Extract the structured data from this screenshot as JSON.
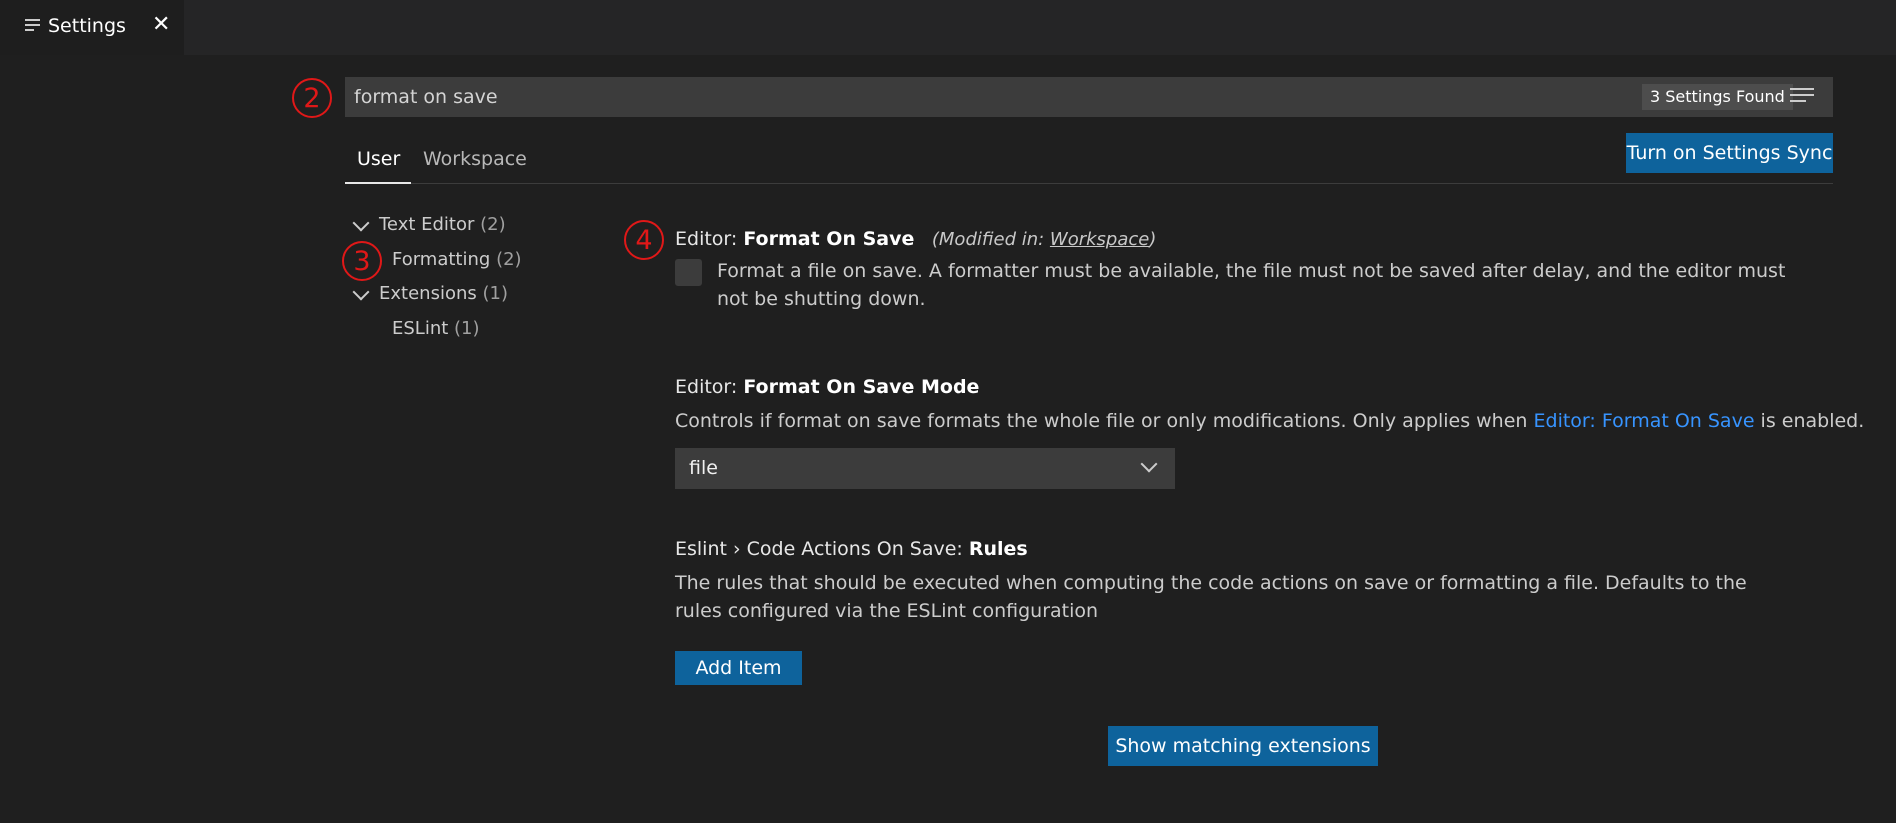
{
  "tab": {
    "title": "Settings",
    "close": "✕"
  },
  "annotations": {
    "search": "2",
    "toc": "3",
    "setting": "4"
  },
  "search": {
    "value": "format on save",
    "found": "3 Settings Found"
  },
  "scopes": {
    "user": "User",
    "workspace": "Workspace"
  },
  "sync_button": "Turn on Settings Sync",
  "toc": [
    {
      "label": "Text Editor",
      "count": "(2)"
    },
    {
      "label": "Formatting",
      "count": "(2)"
    },
    {
      "label": "Extensions",
      "count": "(1)"
    },
    {
      "label": "ESLint",
      "count": "(1)"
    }
  ],
  "settings": {
    "format_on_save": {
      "category": "Editor: ",
      "name": "Format On Save",
      "modified_prefix": "(Modified in: ",
      "modified_link": "Workspace",
      "modified_suffix": ")",
      "description": "Format a file on save. A formatter must be available, the file must not be saved after delay, and the editor must not be shutting down.",
      "checked": false
    },
    "format_on_save_mode": {
      "category": "Editor: ",
      "name": "Format On Save Mode",
      "desc_before": "Controls if format on save formats the whole file or only modifications. Only applies when ",
      "desc_link": "Editor: Format On Save",
      "desc_after": " is enabled.",
      "value": "file"
    },
    "eslint_rules": {
      "category": "Eslint › Code Actions On Save: ",
      "name": "Rules",
      "description": "The rules that should be executed when computing the code actions on save or formatting a file. Defaults to the rules configured via the ESLint configuration",
      "button": "Add Item"
    }
  },
  "show_extensions_button": "Show matching extensions",
  "colors": {
    "background": "#1f1f1f",
    "accent": "#0e639c",
    "link": "#3794ff",
    "annotation": "#e01818"
  }
}
